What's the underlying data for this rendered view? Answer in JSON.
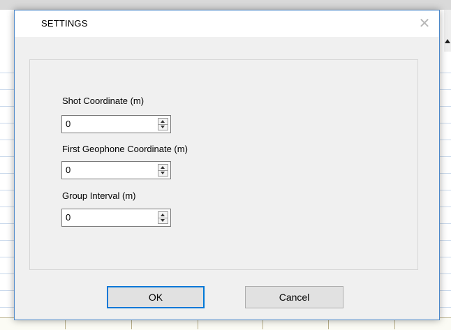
{
  "dialog": {
    "title": "SETTINGS",
    "close_glyph": "✕"
  },
  "fields": {
    "shot_coordinate": {
      "label": "Shot Coordinate (m)",
      "value": "0"
    },
    "first_geophone_coordinate": {
      "label": "First Geophone Coordinate (m)",
      "value": "0"
    },
    "group_interval": {
      "label": "Group Interval (m)",
      "value": "0"
    }
  },
  "buttons": {
    "ok_label": "OK",
    "cancel_label": "Cancel"
  },
  "colors": {
    "dialog_border": "#4b87c9",
    "focus_accent": "#0078d7",
    "dialog_background": "#f0f0f0"
  },
  "icons": {
    "close": "close-icon",
    "spin_up": "spin-up-arrow-icon",
    "spin_down": "spin-down-arrow-icon"
  }
}
